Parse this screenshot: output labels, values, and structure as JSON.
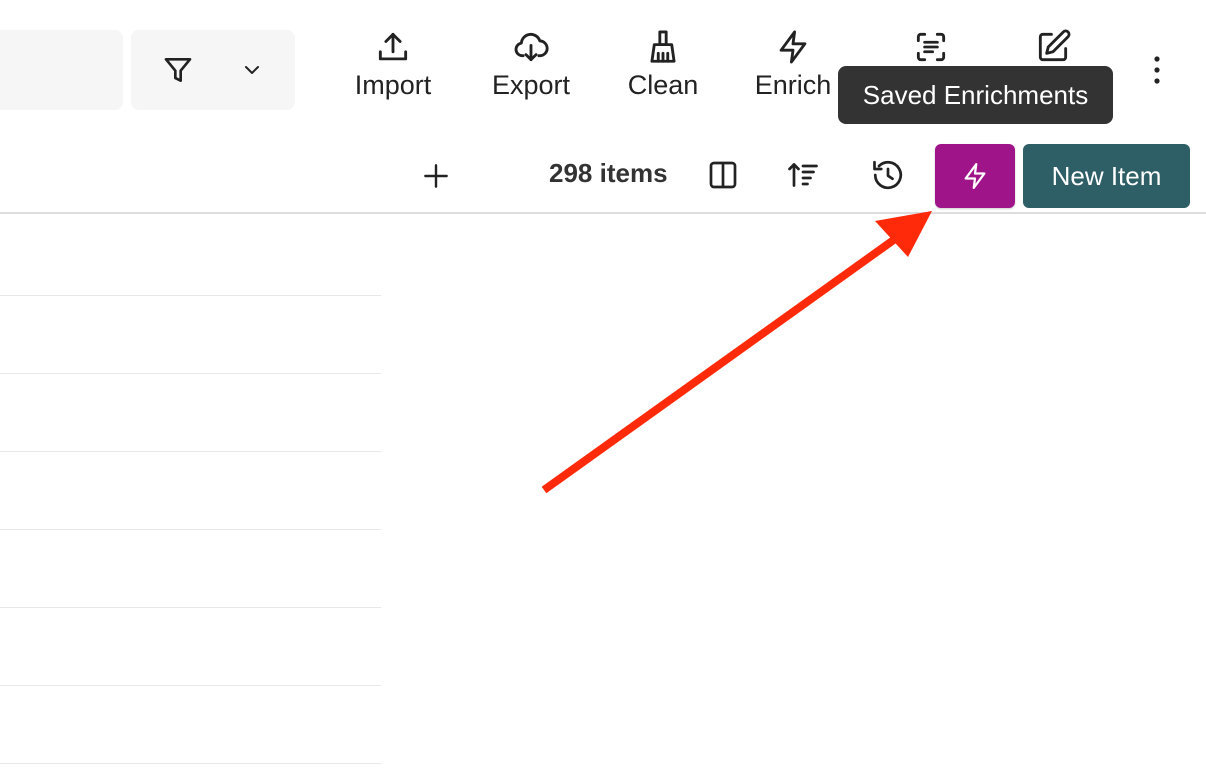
{
  "toolbar": {
    "import_label": "Import",
    "export_label": "Export",
    "clean_label": "Clean",
    "enrich_label": "Enrich"
  },
  "tooltip": {
    "text": "Saved Enrichments"
  },
  "list_header": {
    "item_count": "298 items",
    "new_item_label": "New Item"
  },
  "colors": {
    "enrich_button": "#a0148a",
    "new_item_button": "#2e5e66",
    "tooltip_bg": "#333333",
    "annotation_arrow": "#ff2a0a"
  },
  "icons": {
    "filter": "filter-icon",
    "dropdown": "chevron-down-icon",
    "import": "upload-icon",
    "export": "cloud-download-icon",
    "clean": "broom-icon",
    "enrich": "lightning-icon",
    "saved_enrichments": "scan-text-icon",
    "edit": "edit-icon",
    "more": "more-vertical-icon",
    "add_column": "plus-icon",
    "columns": "columns-icon",
    "sort": "sort-icon",
    "history": "history-icon",
    "saved_enrichments_button": "lightning-icon"
  }
}
